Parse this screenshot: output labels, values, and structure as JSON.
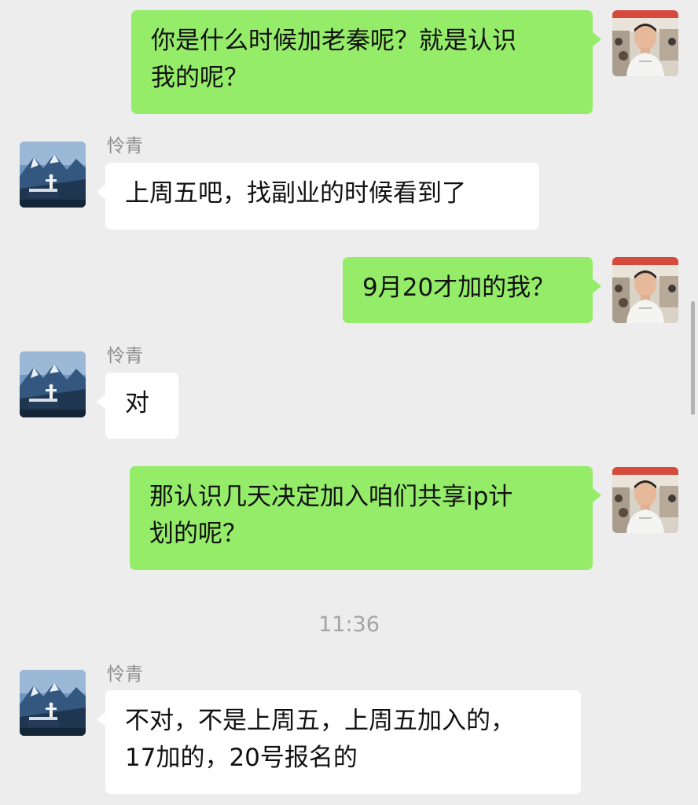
{
  "contact": {
    "name": "怜青"
  },
  "messages": [
    {
      "from": "me",
      "lines": [
        "你是什么时候加老秦呢？就是认识",
        "我的呢？"
      ]
    },
    {
      "from": "them",
      "sender": "怜青",
      "lines": [
        "上周五吧，找副业的时候看到了"
      ]
    },
    {
      "from": "me",
      "lines": [
        "9月20才加的我？"
      ]
    },
    {
      "from": "them",
      "sender": "怜青",
      "lines": [
        "对"
      ]
    },
    {
      "from": "me",
      "lines": [
        "那认识几天决定加入咱们共享ip计",
        "划的呢？"
      ]
    },
    {
      "timestamp": "11:36"
    },
    {
      "from": "them",
      "sender": "怜青",
      "lines": [
        "不对，不是上周五，上周五加入的，",
        "17加的，20号报名的"
      ]
    }
  ],
  "colors": {
    "background": "#ededed",
    "my_bubble": "#95ec69",
    "their_bubble": "#ffffff",
    "sender_name": "#8c8c8c",
    "timestamp": "#a3a3a3"
  },
  "icons": {
    "my_avatar": "user-photo-avatar",
    "their_avatar": "mountain-landscape-avatar"
  }
}
